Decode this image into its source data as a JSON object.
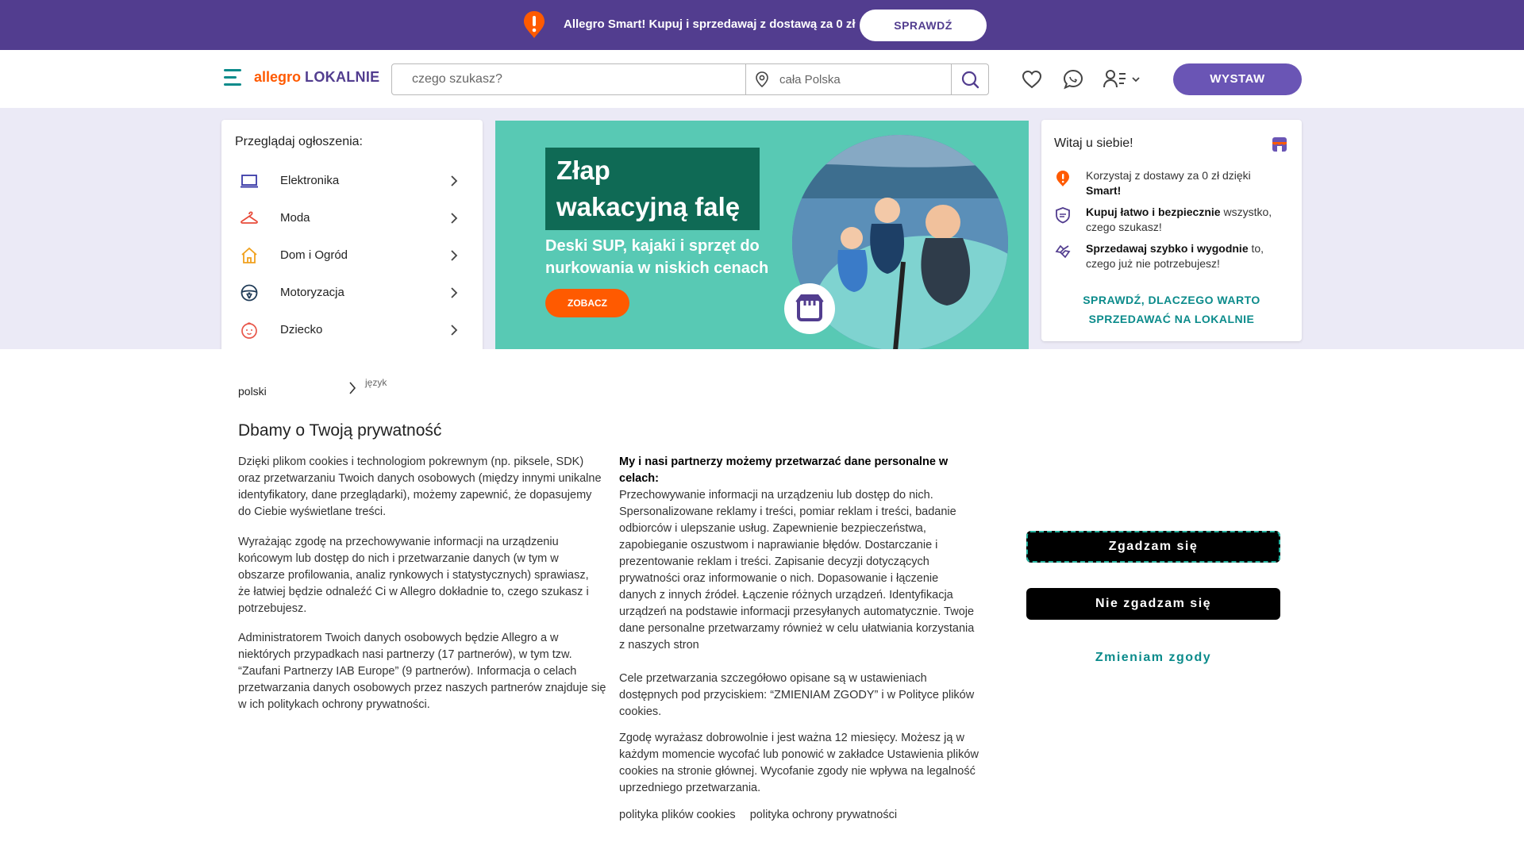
{
  "promo": {
    "text": "Allegro Smart! Kupuj i sprzedawaj z dostawą za 0 zł",
    "button": "SPRAWDŹ",
    "icon": "smart-alert-icon"
  },
  "header": {
    "logo_part1": "allegro",
    "logo_part2": "LOKALNIE",
    "search_placeholder": "czego szukasz?",
    "location_placeholder": "cała Polska",
    "sell_button": "WYSTAW",
    "icons": [
      "menu-icon",
      "location-pin-icon",
      "search-icon",
      "heart-icon",
      "chat-icon",
      "user-icon",
      "chevron-down-icon"
    ]
  },
  "categories": {
    "title": "Przeglądaj ogłoszenia:",
    "items": [
      {
        "label": "Elektronika",
        "icon": "laptop-icon"
      },
      {
        "label": "Moda",
        "icon": "hanger-icon"
      },
      {
        "label": "Dom i Ogród",
        "icon": "house-icon"
      },
      {
        "label": "Motoryzacja",
        "icon": "steering-wheel-icon"
      },
      {
        "label": "Dziecko",
        "icon": "baby-icon"
      }
    ]
  },
  "banner": {
    "title": "Złap wakacyjną falę",
    "subtitle": "Deski SUP, kajaki i sprzęt do nurkowania w niskich cenach",
    "button": "ZOBACZ"
  },
  "welcome": {
    "title": "Witaj u siebie!",
    "items": [
      {
        "pre": "Korzystaj z dostawy za 0 zł dzięki ",
        "bold": "Smart!",
        "post": "",
        "icon": "smart-icon"
      },
      {
        "pre": "",
        "bold": "Kupuj łatwo i bezpiecznie",
        "post": " wszystko, czego szukasz!",
        "icon": "shield-icon"
      },
      {
        "pre": "",
        "bold": "Sprzedawaj szybko i wygodnie",
        "post": " to, czego już nie potrzebujesz!",
        "icon": "handshake-icon"
      }
    ],
    "link_line1": "SPRAWDŹ, DLACZEGO WARTO",
    "link_line2": "SPRZEDAWAĆ NA LOKALNIE"
  },
  "consent": {
    "language_value": "polski",
    "language_label": "język",
    "title": "Dbamy o Twoją prywatność",
    "left_paragraphs": [
      "Dzięki plikom cookies i technologiom pokrewnym (np. piksele, SDK) oraz przetwarzaniu Twoich danych osobowych (między innymi unikalne identyfikatory, dane przeglądarki), możemy zapewnić, że dopasujemy do Ciebie wyświetlane treści.",
      "Wyrażając zgodę na przechowywanie informacji na urządzeniu końcowym lub dostęp do nich i przetwarzanie danych (w tym w obszarze profilowania, analiz rynkowych i statystycznych) sprawiasz, że łatwiej będzie odnaleźć Ci w Allegro dokładnie to, czego szukasz i potrzebujesz.",
      "Administratorem Twoich danych osobowych będzie Allegro a w niektórych przypadkach nasi partnerzy (17 partnerów), w tym tzw. “Zaufani Partnerzy IAB Europe” (9 partnerów). Informacja o celach przetwarzania danych osobowych przez naszych partnerów znajduje się w ich politykach ochrony prywatności."
    ],
    "purposes_heading": "My i nasi partnerzy możemy przetwarzać dane personalne w celach:",
    "purposes_text": "Przechowywanie informacji na urządzeniu lub dostęp do nich. Spersonalizowane reklamy i treści, pomiar reklam i treści, badanie odbiorców i ulepszanie usług. Zapewnienie bezpieczeństwa, zapobieganie oszustwom i naprawianie błędów. Dostarczanie i prezentowanie reklam i treści. Zapisanie decyzji dotyczących prywatności oraz informowanie o nich. Dopasowanie i łączenie danych z innych źródeł. Łączenie różnych urządzeń. Identyfikacja urządzeń na podstawie informacji przesyłanych automatycznie. Twoje dane personalne przetwarzamy również w celu ułatwiania korzystania z naszych stron",
    "details_text": "Cele przetwarzania szczegółowo opisane są w ustawieniach dostępnych pod przyciskiem: “ZMIENIAM ZGODY” i w Polityce plików cookies.",
    "voluntary_text": "Zgodę wyrażasz dobrowolnie i jest ważna 12 miesięcy. Możesz ją w każdym momencie wycofać lub ponowić w zakładce Ustawienia plików cookies na stronie głównej. Wycofanie zgody nie wpływa na legalność uprzedniego przetwarzania.",
    "link_cookies": "polityka plików cookies",
    "link_privacy": "polityka ochrony prywatności",
    "accept_button": "Zgadzam się",
    "decline_button": "Nie zgadzam się",
    "change_button": "Zmieniam zgody"
  },
  "colors": {
    "brand_purple": "#523d8f",
    "accent_orange": "#ff5a00",
    "accent_teal": "#0b8b8b"
  }
}
